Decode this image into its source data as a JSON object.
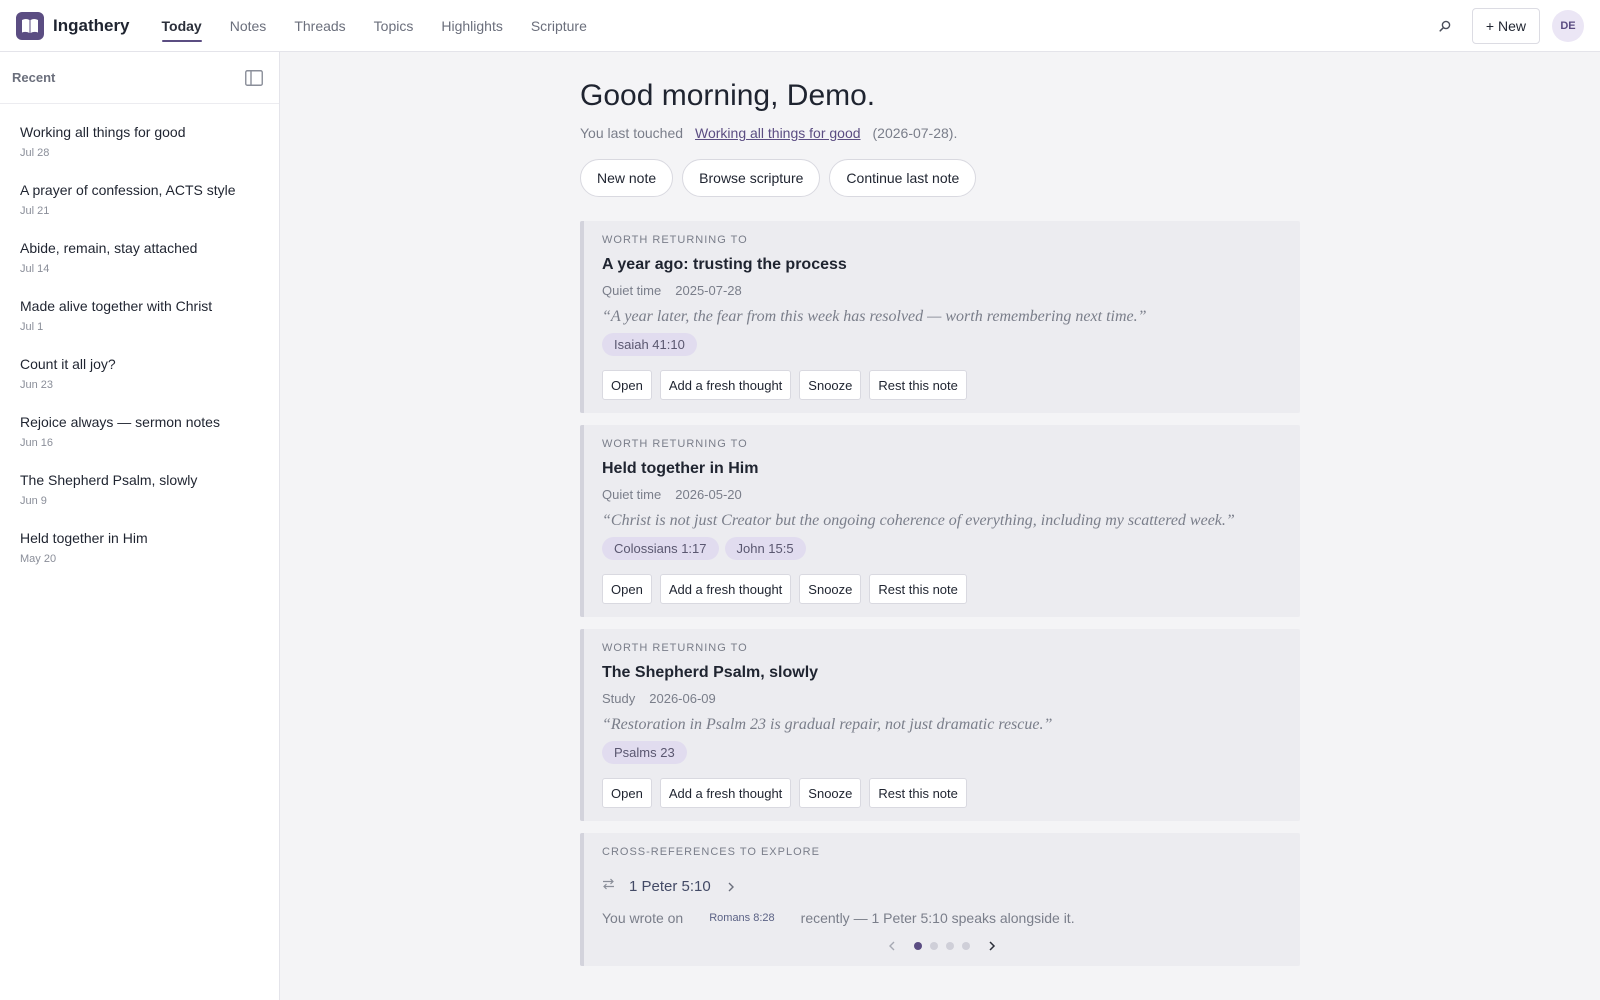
{
  "app": {
    "name": "Ingathery"
  },
  "nav": {
    "items": [
      {
        "label": "Today"
      },
      {
        "label": "Notes"
      },
      {
        "label": "Threads"
      },
      {
        "label": "Topics"
      },
      {
        "label": "Highlights"
      },
      {
        "label": "Scripture"
      }
    ],
    "active": "Today"
  },
  "header": {
    "new_label": "+ New",
    "avatar_initials": "DE",
    "search_icon": "search-icon"
  },
  "sidebar": {
    "title": "Recent",
    "items": [
      {
        "title": "Working all things for good",
        "date": "Jul 28"
      },
      {
        "title": "A prayer of confession, ACTS style",
        "date": "Jul 21"
      },
      {
        "title": "Abide, remain, stay attached",
        "date": "Jul 14"
      },
      {
        "title": "Made alive together with Christ",
        "date": "Jul 1"
      },
      {
        "title": "Count it all joy?",
        "date": "Jun 23"
      },
      {
        "title": "Rejoice always — sermon notes",
        "date": "Jun 16"
      },
      {
        "title": "The Shepherd Psalm, slowly",
        "date": "Jun 9"
      },
      {
        "title": "Held together in Him",
        "date": "May 20"
      }
    ]
  },
  "main": {
    "greeting": "Good morning, Demo.",
    "last_touched": {
      "prefix": "You last touched",
      "link": "Working all things for good",
      "suffix": "(2026-07-28)."
    },
    "quick_actions": [
      "New note",
      "Browse scripture",
      "Continue last note"
    ],
    "cards": [
      {
        "kicker": "WORTH RETURNING TO",
        "title": "A year ago: trusting the process",
        "type": "Quiet time",
        "date": "2025-07-28",
        "quote": "“A year later, the fear from this week has resolved — worth remembering next time.”",
        "tags": [
          "Isaiah 41:10"
        ]
      },
      {
        "kicker": "WORTH RETURNING TO",
        "title": "Held together in Him",
        "type": "Quiet time",
        "date": "2026-05-20",
        "quote": "“Christ is not just Creator but the ongoing coherence of everything, including my scattered week.”",
        "tags": [
          "Colossians 1:17",
          "John 15:5"
        ]
      },
      {
        "kicker": "WORTH RETURNING TO",
        "title": "The Shepherd Psalm, slowly",
        "type": "Study",
        "date": "2026-06-09",
        "quote": "“Restoration in Psalm 23 is gradual repair, not just dramatic rescue.”",
        "tags": [
          "Psalms 23"
        ]
      }
    ],
    "card_actions": [
      "Open",
      "Add a fresh thought",
      "Snooze",
      "Rest this note"
    ],
    "xref": {
      "kicker": "CROSS-REFERENCES TO EXPLORE",
      "reference": "1 Peter 5:10",
      "text_prefix": "You wrote on",
      "inline_ref": "Romans 8:28",
      "text_suffix": "recently — 1 Peter 5:10 speaks alongside it.",
      "page": 1,
      "page_count": 4
    }
  },
  "colors": {
    "accent": "#5b4d82",
    "tag_bg": "#e1dcef",
    "card_bg": "#ececf0"
  }
}
